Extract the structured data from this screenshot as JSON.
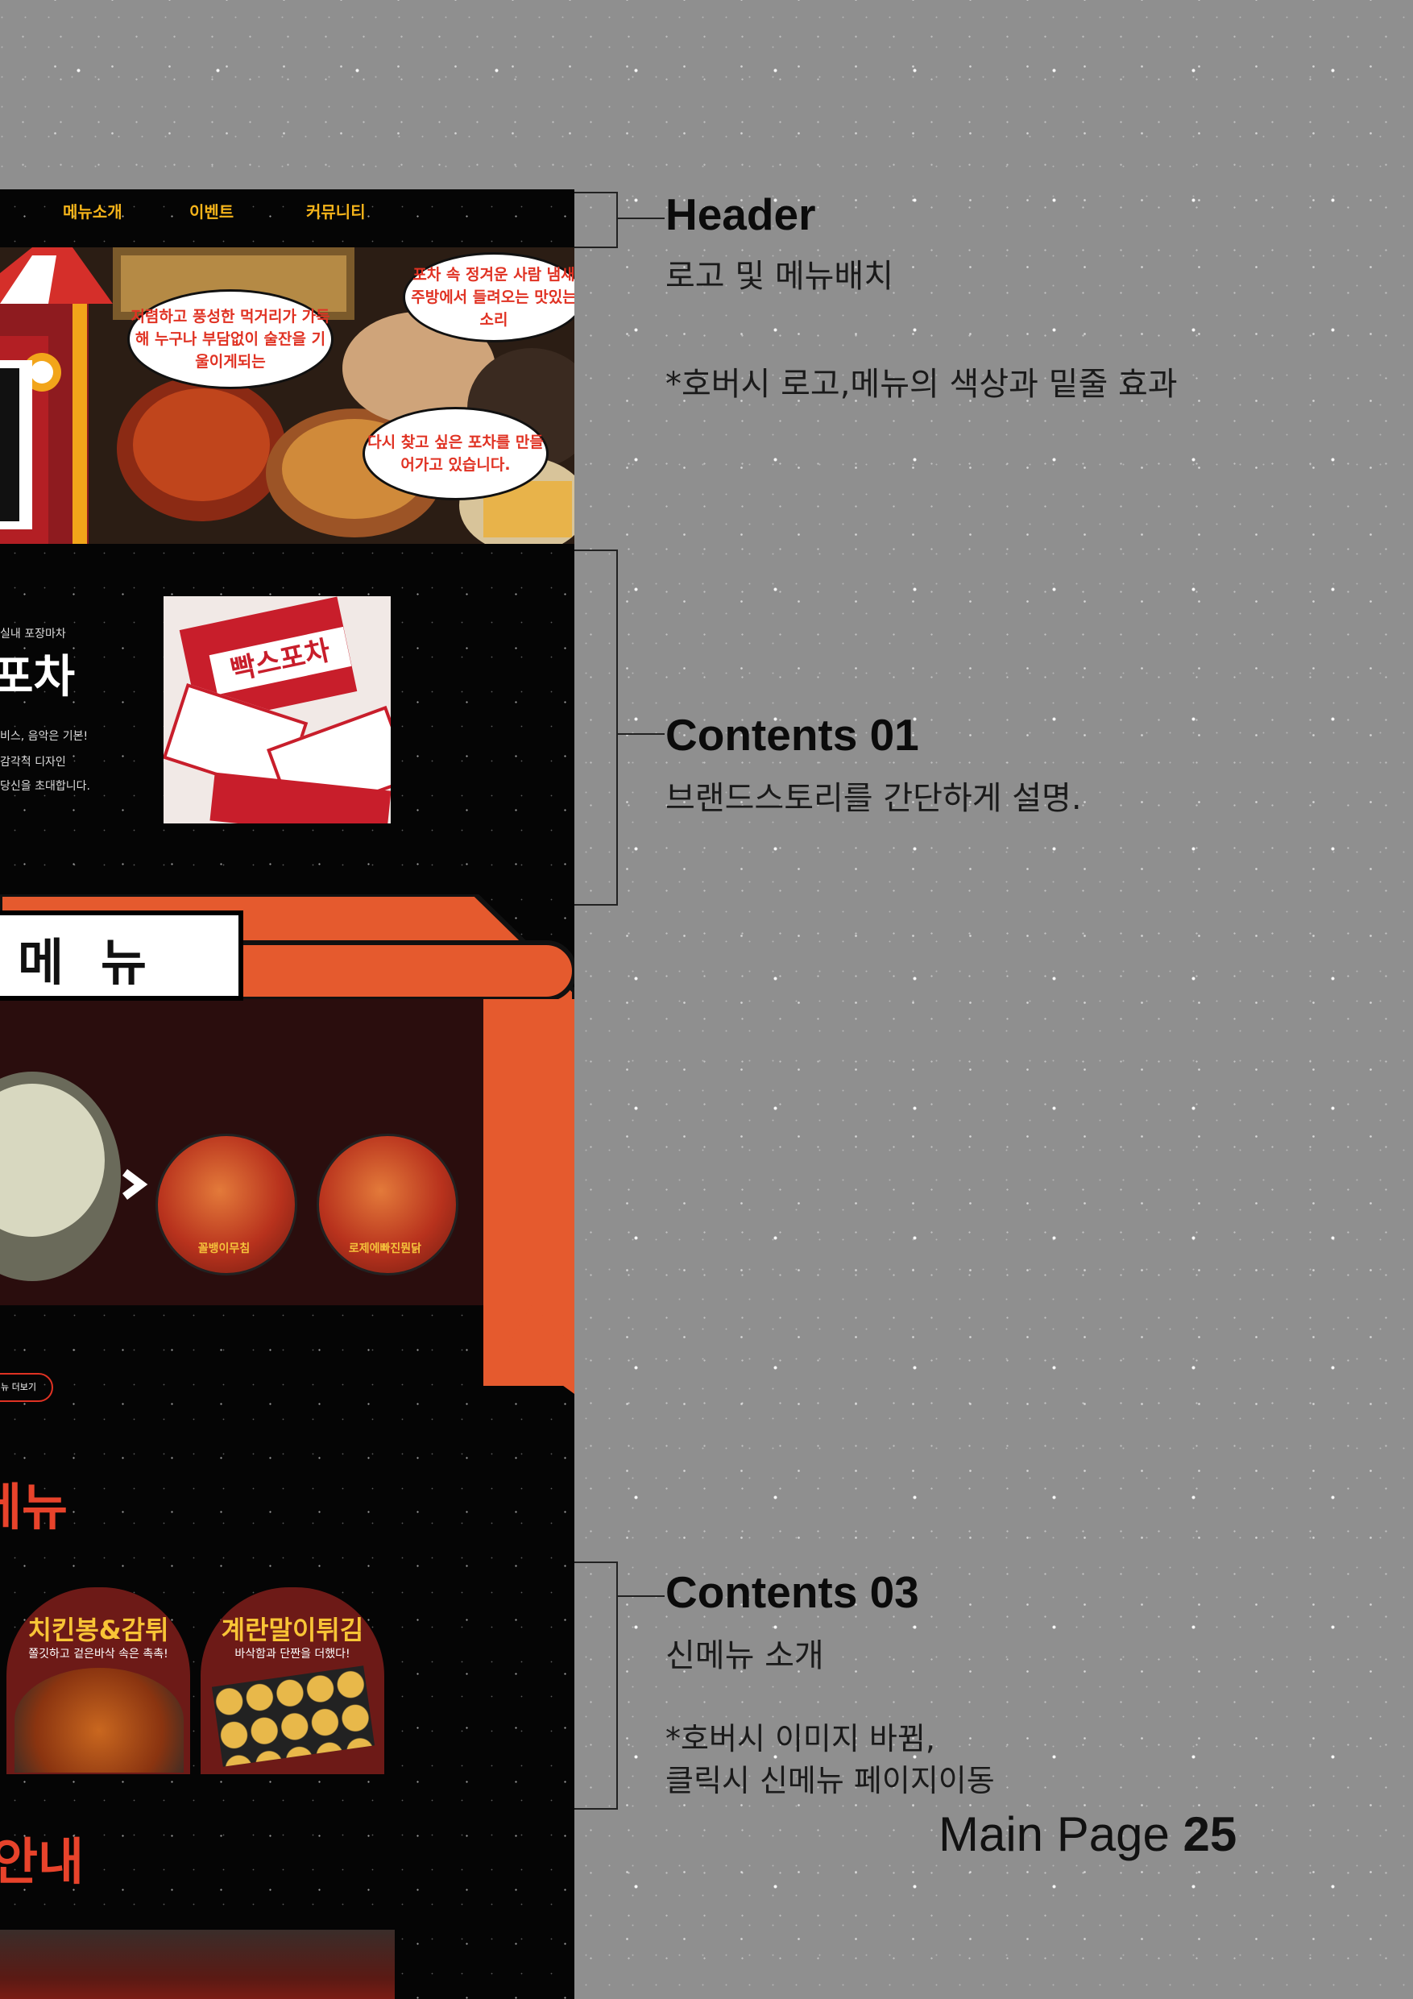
{
  "site": {
    "nav": {
      "menu": "메뉴소개",
      "event": "이벤트",
      "community": "커뮤니티"
    },
    "hero": {
      "bubble_1": "포차 속 정겨운 사람 냄새 주방에서 들려오는 맛있는소리",
      "bubble_2": "저렴하고 풍성한 먹거리가 가득해 누구나 부담없이 술잔을 기울이게되는",
      "bubble_3": "다시 찾고 싶은 포차를 만들어가고 있습니다."
    },
    "brand": {
      "tagline": "실내 포장마차",
      "title": "포차",
      "line_1": "비스, 음악은 기본!",
      "line_2": "감각적 디자인",
      "line_3": "당신을 초대합니다.",
      "card_logo": "빡스포차"
    },
    "menu": {
      "sign": "메뉴",
      "dish_1_label": "꼴뱅이무침",
      "dish_2_label": "로제에빠진뭔닭",
      "more_button": "메뉴 더보기"
    },
    "new_menu": {
      "section_title": "메뉴",
      "cards": [
        {
          "title": "치킨봉&감튀",
          "subtitle": "쫄깃하고 겉은바삭 속은 촉촉!"
        },
        {
          "title": "계란말이튀김",
          "subtitle": "바삭함과 단짠을 더했다!"
        }
      ]
    },
    "store_info_title": "안내"
  },
  "annotations": {
    "header": {
      "title": "Header",
      "desc": "로고 및 메뉴배치",
      "note": "*호버시 로고,메뉴의 색상과 밑줄 효과"
    },
    "contents_01": {
      "title": "Contents 01",
      "desc": "브랜드스토리를 간단하게 설명."
    },
    "contents_03": {
      "title": "Contents 03",
      "desc": "신메뉴 소개",
      "note_line_1": "*호버시 이미지 바뀜,",
      "note_line_2": "클릭시 신메뉴 페이지이동"
    }
  },
  "footer": {
    "page_label": "Main Page",
    "page_number": "25"
  },
  "colors": {
    "accent_yellow": "#f5b41a",
    "accent_red": "#e8432b",
    "awning_orange": "#e55a2e",
    "background_gray": "#8f8f8f"
  }
}
